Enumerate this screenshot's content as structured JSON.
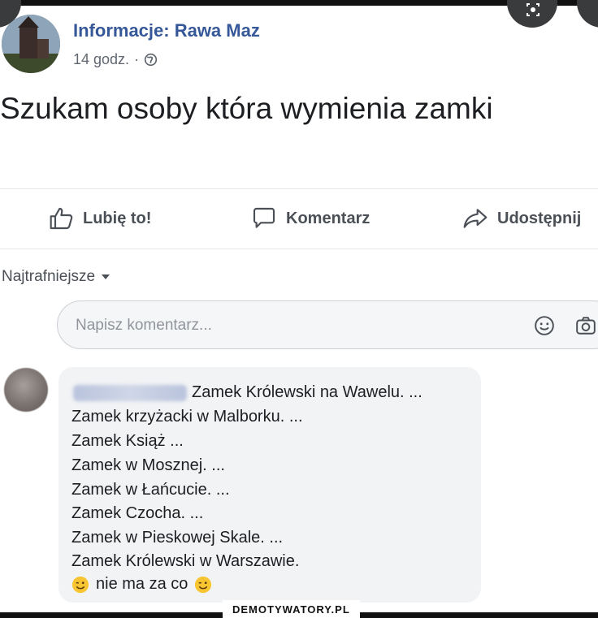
{
  "post": {
    "author": "Informacje: Rawa Maz",
    "time": "14 godz.",
    "separator": "·",
    "privacy_icon": "globe-icon",
    "text": "Szukam osoby która wymienia zamki"
  },
  "actions": {
    "like": "Lubię to!",
    "comment": "Komentarz",
    "share": "Udostępnij"
  },
  "sort": {
    "label": "Najtrafniejsze"
  },
  "composer": {
    "placeholder": "Napisz komentarz..."
  },
  "comment": {
    "lines": [
      "Zamek Królewski na Wawelu. ...",
      "Zamek krzyżacki w Malborku. ...",
      "Zamek Książ ...",
      "Zamek w Mosznej. ...",
      "Zamek w Łańcucie. ...",
      "Zamek Czocha. ...",
      "Zamek w Pieskowej Skale. ...",
      "Zamek Królewski w Warszawie."
    ],
    "closing": "nie ma za co"
  },
  "watermark": "DEMOTYWATORY.PL",
  "colors": {
    "author_link": "#365899",
    "muted": "#616770",
    "bubble": "#f2f3f5",
    "action": "#4b4f56"
  }
}
